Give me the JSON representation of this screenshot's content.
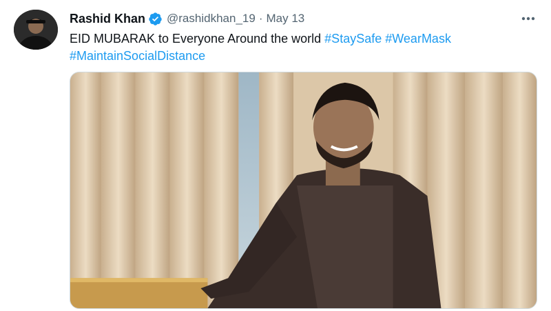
{
  "tweet": {
    "author_name": "Rashid Khan",
    "handle": "@rashidkhan_19",
    "separator": "·",
    "date": "May 13",
    "text": "EID MUBARAK to Everyone Around the world ",
    "hashtags": [
      "#StaySafe",
      "#WearMask",
      "#MaintainSocialDistance"
    ],
    "more_icon": "more-horizontal-icon",
    "verified_icon": "verified-badge-icon"
  },
  "colors": {
    "link": "#1d9bf0",
    "text": "#0f1419",
    "muted": "#536471",
    "border": "#cfd9de"
  }
}
